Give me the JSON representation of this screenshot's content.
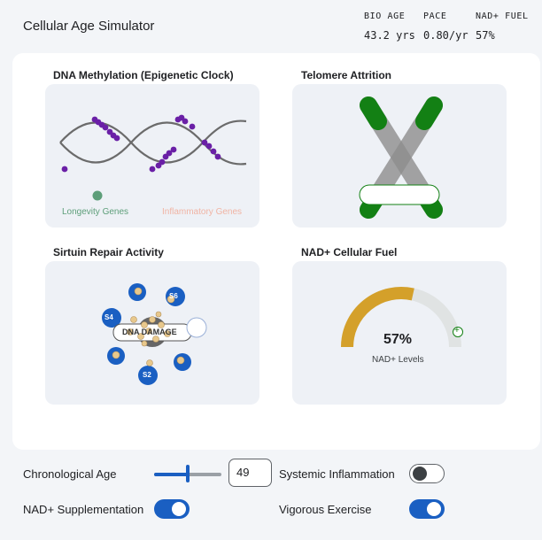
{
  "app": {
    "title": "Cellular Age Simulator"
  },
  "stats": [
    {
      "key": "BIO AGE",
      "value": "43.2 yrs"
    },
    {
      "key": "PACE",
      "value": "0.80/yr"
    },
    {
      "key": "NAD+ FUEL",
      "value": "57%"
    }
  ],
  "cards": {
    "dna": {
      "title": "DNA Methylation (Epigenetic Clock)",
      "legend_left": "Longevity Genes",
      "legend_right": "Inflammatory Genes"
    },
    "telomere": {
      "title": "Telomere Attrition"
    },
    "sirtuin": {
      "title": "Sirtuin Repair Activity",
      "damage_label": "DNA DAMAGE",
      "nodes": [
        "S4",
        "S6",
        "S2"
      ]
    },
    "nad": {
      "title": "NAD+ Cellular Fuel",
      "percent_label": "57%",
      "percent_value": 57,
      "caption": "NAD+ Levels",
      "plus_symbol": "+"
    }
  },
  "controls": {
    "age_label": "Chronological Age",
    "age_value": "49",
    "age_fraction": 0.5,
    "inflammation_label": "Systemic Inflammation",
    "inflammation_on": false,
    "nad_supp_label": "NAD+ Supplementation",
    "nad_supp_on": true,
    "exercise_label": "Vigorous Exercise",
    "exercise_on": true
  },
  "colors": {
    "accent": "#1a5fc2",
    "methyl": "#6a1fa6",
    "telomere_cap": "#138014",
    "gauge_fill": "#d4a02a",
    "gauge_track": "#e0e3e3",
    "longevity": "#5d9e79",
    "inflammatory": "#f0b4a4"
  }
}
